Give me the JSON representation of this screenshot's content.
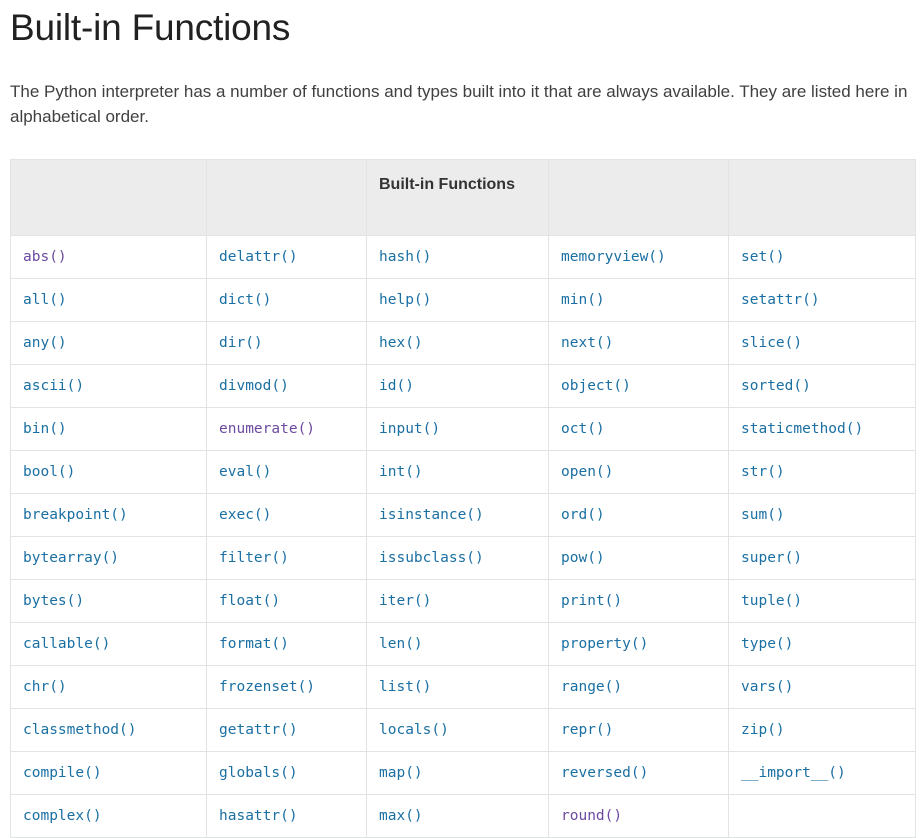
{
  "page": {
    "title": "Built-in Functions",
    "intro": "The Python interpreter has a number of functions and types built into it that are always available. They are listed here in alphabetical order."
  },
  "colors": {
    "link": "#1a6fa3",
    "visited_link": "#6d4aa0",
    "header_background": "#ececec",
    "border": "#e1e4e5",
    "text": "#404040",
    "heading": "#212121"
  },
  "table": {
    "headers": [
      "",
      "",
      "Built-in Functions",
      "",
      ""
    ],
    "rows": [
      [
        {
          "label": "abs()",
          "state": "visited"
        },
        {
          "label": "delattr()",
          "state": "link"
        },
        {
          "label": "hash()",
          "state": "link"
        },
        {
          "label": "memoryview()",
          "state": "link"
        },
        {
          "label": "set()",
          "state": "link"
        }
      ],
      [
        {
          "label": "all()",
          "state": "link"
        },
        {
          "label": "dict()",
          "state": "link"
        },
        {
          "label": "help()",
          "state": "link"
        },
        {
          "label": "min()",
          "state": "link"
        },
        {
          "label": "setattr()",
          "state": "link"
        }
      ],
      [
        {
          "label": "any()",
          "state": "link"
        },
        {
          "label": "dir()",
          "state": "link"
        },
        {
          "label": "hex()",
          "state": "link"
        },
        {
          "label": "next()",
          "state": "link"
        },
        {
          "label": "slice()",
          "state": "link"
        }
      ],
      [
        {
          "label": "ascii()",
          "state": "link"
        },
        {
          "label": "divmod()",
          "state": "link"
        },
        {
          "label": "id()",
          "state": "link"
        },
        {
          "label": "object()",
          "state": "link"
        },
        {
          "label": "sorted()",
          "state": "link"
        }
      ],
      [
        {
          "label": "bin()",
          "state": "link"
        },
        {
          "label": "enumerate()",
          "state": "visited"
        },
        {
          "label": "input()",
          "state": "link"
        },
        {
          "label": "oct()",
          "state": "link"
        },
        {
          "label": "staticmethod()",
          "state": "link"
        }
      ],
      [
        {
          "label": "bool()",
          "state": "link"
        },
        {
          "label": "eval()",
          "state": "link"
        },
        {
          "label": "int()",
          "state": "link"
        },
        {
          "label": "open()",
          "state": "link"
        },
        {
          "label": "str()",
          "state": "link"
        }
      ],
      [
        {
          "label": "breakpoint()",
          "state": "link"
        },
        {
          "label": "exec()",
          "state": "link"
        },
        {
          "label": "isinstance()",
          "state": "link"
        },
        {
          "label": "ord()",
          "state": "link"
        },
        {
          "label": "sum()",
          "state": "link"
        }
      ],
      [
        {
          "label": "bytearray()",
          "state": "link"
        },
        {
          "label": "filter()",
          "state": "link"
        },
        {
          "label": "issubclass()",
          "state": "link"
        },
        {
          "label": "pow()",
          "state": "link"
        },
        {
          "label": "super()",
          "state": "link"
        }
      ],
      [
        {
          "label": "bytes()",
          "state": "link"
        },
        {
          "label": "float()",
          "state": "link"
        },
        {
          "label": "iter()",
          "state": "link"
        },
        {
          "label": "print()",
          "state": "link"
        },
        {
          "label": "tuple()",
          "state": "link"
        }
      ],
      [
        {
          "label": "callable()",
          "state": "link"
        },
        {
          "label": "format()",
          "state": "link"
        },
        {
          "label": "len()",
          "state": "link"
        },
        {
          "label": "property()",
          "state": "link"
        },
        {
          "label": "type()",
          "state": "link"
        }
      ],
      [
        {
          "label": "chr()",
          "state": "link"
        },
        {
          "label": "frozenset()",
          "state": "link"
        },
        {
          "label": "list()",
          "state": "link"
        },
        {
          "label": "range()",
          "state": "link"
        },
        {
          "label": "vars()",
          "state": "link"
        }
      ],
      [
        {
          "label": "classmethod()",
          "state": "link"
        },
        {
          "label": "getattr()",
          "state": "link"
        },
        {
          "label": "locals()",
          "state": "link"
        },
        {
          "label": "repr()",
          "state": "link"
        },
        {
          "label": "zip()",
          "state": "link"
        }
      ],
      [
        {
          "label": "compile()",
          "state": "link"
        },
        {
          "label": "globals()",
          "state": "link"
        },
        {
          "label": "map()",
          "state": "link"
        },
        {
          "label": "reversed()",
          "state": "link"
        },
        {
          "label": "__import__()",
          "state": "link"
        }
      ],
      [
        {
          "label": "complex()",
          "state": "link"
        },
        {
          "label": "hasattr()",
          "state": "link"
        },
        {
          "label": "max()",
          "state": "link"
        },
        {
          "label": "round()",
          "state": "visited"
        },
        {
          "label": "",
          "state": "empty"
        }
      ]
    ]
  }
}
